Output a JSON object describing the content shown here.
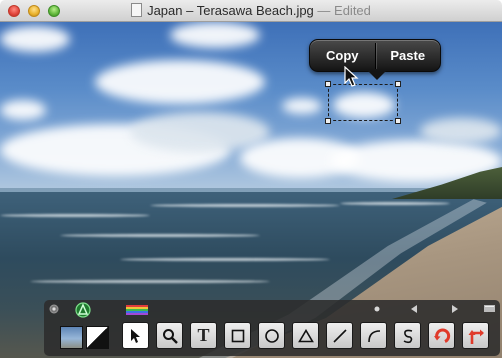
{
  "window": {
    "filename": "Japan – Terasawa Beach.jpg",
    "status": "— Edited"
  },
  "popover": {
    "copy_label": "Copy",
    "paste_label": "Paste"
  },
  "toolbar": {
    "tools": [
      {
        "name": "select-arrow-tool"
      },
      {
        "name": "zoom-tool"
      },
      {
        "name": "text-tool",
        "glyph": "T"
      },
      {
        "name": "rectangle-tool"
      },
      {
        "name": "oval-tool"
      },
      {
        "name": "triangle-tool"
      },
      {
        "name": "line-tool"
      },
      {
        "name": "arc-tool"
      },
      {
        "name": "freehand-tool"
      },
      {
        "name": "rotate-tool"
      },
      {
        "name": "crop-arrow-tool"
      }
    ],
    "colors": {
      "accent_green": "#33b34a",
      "accent_red": "#e03a2a",
      "toolbar_bg": "#2c2c2c"
    }
  }
}
